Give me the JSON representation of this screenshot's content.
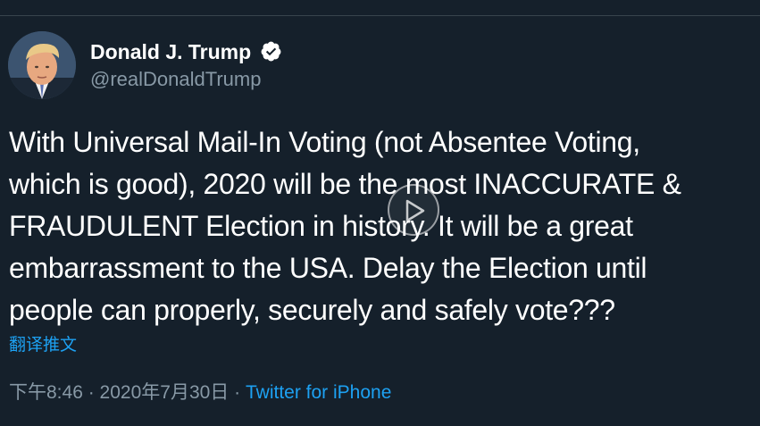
{
  "author": {
    "name": "Donald J. Trump",
    "handle": "@realDonaldTrump",
    "verified": true
  },
  "tweet": {
    "text": "With Universal Mail-In Voting (not Absentee Voting,\nwhich is good), 2020 will be the most INACCURATE &\nFRAUDULENT Election in history. It will be a great\nembarrassment to the USA. Delay the Election until\npeople can properly, securely and safely vote???",
    "translate_label": "翻译推文"
  },
  "meta": {
    "time": "下午8:46",
    "separator_1": " · ",
    "date": "2020年7月30日",
    "separator_2": " · ",
    "source": "Twitter for iPhone"
  },
  "colors": {
    "background": "#15202b",
    "text": "#ffffff",
    "secondary_text": "#8899a6",
    "accent": "#1da1f2",
    "divider": "#38444d"
  },
  "icons": {
    "verified": "verified-badge-icon",
    "play": "play-icon"
  }
}
